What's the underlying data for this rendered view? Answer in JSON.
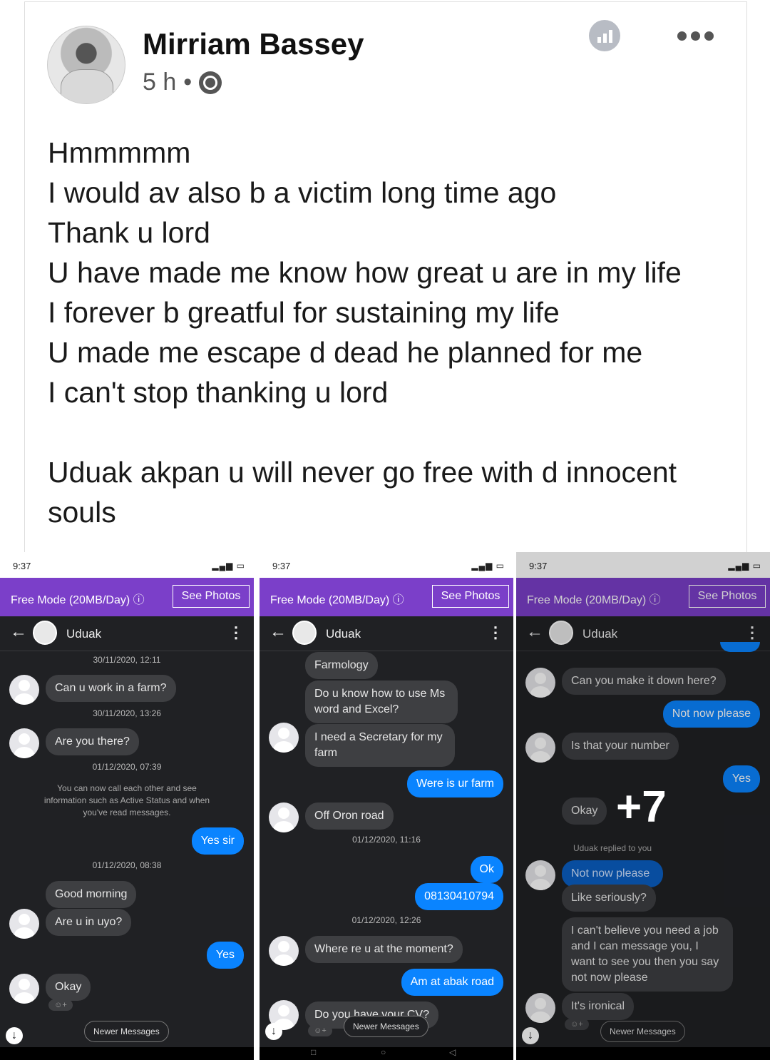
{
  "post": {
    "author": "Mirriam Bassey",
    "time": "5 h",
    "separator": "•",
    "lines": [
      "Hmmmmm",
      "I would av also b a victim long time  ago",
      "Thank u lord",
      "U have made me know how great u are in my life",
      "I forever b greatful for sustaining my life",
      "U made me escape d dead he planned for me",
      "I can't stop thanking u lord",
      "",
      "Uduak akpan u will never go free with d innocent",
      "souls"
    ]
  },
  "phones": [
    {
      "status_time": "9:37",
      "free_mode": "Free Mode (20MB/Day) ⓘ",
      "see_photos": "See Photos",
      "contact": "Uduak",
      "items": {
        "ts1": "30/11/2020, 12:11",
        "m1": "Can u work in a farm?",
        "ts2": "30/11/2020, 13:26",
        "m2": "Are you there?",
        "ts3": "01/12/2020, 07:39",
        "sys": "You can now call each other and see information such as Active Status and when you've read messages.",
        "m3": "Yes sir",
        "ts4": "01/12/2020, 08:38",
        "m4": "Good morning",
        "m5": "Are u in uyo?",
        "m6": "Yes",
        "m7": "Okay",
        "newer": "Newer Messages"
      }
    },
    {
      "status_time": "9:37",
      "free_mode": "Free Mode (20MB/Day) ⓘ",
      "see_photos": "See Photos",
      "contact": "Uduak",
      "items": {
        "m1": "Farmology",
        "m2": "Do u know how to use Ms word and Excel?",
        "m3": "I need a Secretary for my farm",
        "m4": "Were is ur farm",
        "m5": "Off Oron road",
        "ts1": "01/12/2020, 11:16",
        "m6": "Ok",
        "m7": "08130410794",
        "ts2": "01/12/2020, 12:26",
        "m8": "Where re u at the moment?",
        "m9": "Am at abak road",
        "m10": "Do you have your CV?",
        "newer": "Newer Messages"
      }
    },
    {
      "status_time": "9:37",
      "free_mode": "Free Mode (20MB/Day) ⓘ",
      "see_photos": "See Photos",
      "contact": "Uduak",
      "items": {
        "m1": "Can you make it down here?",
        "m2": "Not now please",
        "m3": "Is that your number",
        "m4": "Yes",
        "m5": "Okay",
        "more": "+7",
        "replied": "Uduak replied to you",
        "m6": "Not now please",
        "m7": "Like seriously?",
        "m8": "I can't believe you need a job and I can message you, I want to see you then you say not now please",
        "m9": "It's ironical",
        "newer": "Newer Messages"
      }
    }
  ]
}
